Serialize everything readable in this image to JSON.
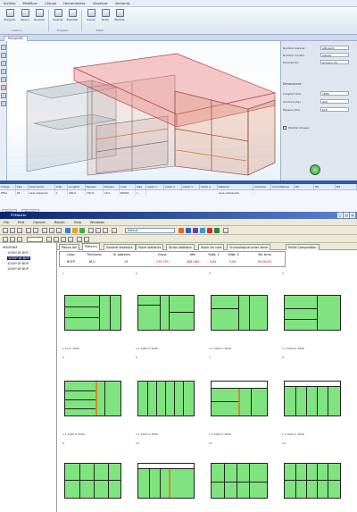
{
  "app": {
    "menu": [
      "Archivo",
      "Modificar",
      "Cálculo",
      "Herramientas",
      "Visualizar",
      "Ventanas"
    ],
    "ribbon": [
      {
        "label": "Proyecto",
        "icon": "folder-icon"
      },
      {
        "label": "Nuevo",
        "icon": "new-file-icon"
      },
      {
        "label": "Guardar",
        "icon": "save-icon"
      },
      {
        "label": "Insertar",
        "icon": "insert-icon"
      },
      {
        "label": "Exportar",
        "icon": "export-icon"
      },
      {
        "label": "Copiar",
        "icon": "copy-icon"
      },
      {
        "label": "Rotar",
        "icon": "rotate-icon"
      },
      {
        "label": "Medida",
        "icon": "measure-icon"
      }
    ],
    "ribbon_groups": [
      "Archivo",
      "Proyecto",
      "Editar"
    ],
    "doc_tab": "MiCapCAD",
    "props": {
      "fields": [
        {
          "label": "Nombre Cabinet",
          "value": "AltCab23"
        },
        {
          "label": "Nombre modelo",
          "value": "AltCab"
        },
        {
          "label": "Descripción",
          "value": "Armario 23"
        }
      ],
      "dimensions_header": "Dimensiones",
      "dims": [
        {
          "label": "Longitud (Dx)",
          "value": "1800"
        },
        {
          "label": "Anchura (Dy)",
          "value": "900"
        },
        {
          "label": "Espesor (Dz)",
          "value": "600"
        }
      ],
      "checkbox": "Mostrar imagen"
    },
    "table": {
      "headers": [
        "Código",
        "Tipo",
        "Descripción",
        "Z-Pic",
        "Longitud",
        "Espesor",
        "Espesor",
        "Color",
        "Veta",
        "Canto 1",
        "Canto 2",
        "Canto 3",
        "Canto 4",
        "Material",
        "Cantidad",
        "Cant.Material",
        "M1",
        "M2",
        "M3"
      ],
      "row": [
        "PTSA",
        "P2",
        "Lado izquierdo",
        "1",
        "900.0",
        "370.0",
        "19.0",
        "BOP16",
        "1",
        "",
        "",
        "",
        "",
        "Laca, blanquedo",
        "",
        "",
        "",
        "",
        ""
      ],
      "bottom_tabs": [
        "Piezas",
        "Herrajes"
      ]
    }
  },
  "optimizer": {
    "title": "PSMaster",
    "window_buttons": [
      "_",
      "□",
      "×"
    ],
    "menu": [
      "File",
      "Edit",
      "Options",
      "Report",
      "Help",
      "Windows"
    ],
    "combo": "Default",
    "tree": {
      "root": "MAGENM",
      "items": [
        "1000*18 BOF",
        "1000*18 BOP",
        "1000*18 BOP",
        "1000*18 BOP"
      ]
    },
    "tabs": [
      "Pieces list",
      "Patterns",
      "General statistics",
      "Panel statistics",
      "Strips statistics",
      "Stock for cuts",
      "Chronological order stock",
      "Pallet Composition"
    ],
    "stats": {
      "headers": [
        "Color",
        "Thickness",
        "N. patterns",
        "Gross",
        "Net",
        "%Wa. 1",
        "%Wa. 2",
        "Tot. time"
      ],
      "values": [
        "BOFP",
        "18,0",
        "13",
        "279,791",
        "264,084",
        "5,62",
        "5,63",
        "00:00:52"
      ]
    },
    "cells": [
      {
        "num": "1",
        "caption": "x 12 0, 1000"
      },
      {
        "num": "2",
        "caption": "x 1 1000 X 3040"
      },
      {
        "num": "3",
        "caption": "x 1 1000 X 3040"
      },
      {
        "num": "4",
        "caption": "x 1 1000 X 3040"
      },
      {
        "num": "5",
        "caption": "x 1 1000 X 3040"
      },
      {
        "num": "6",
        "caption": "x 1 1000 X 3040"
      },
      {
        "num": "7",
        "caption": "x 1 1000 X 3040"
      },
      {
        "num": "8",
        "caption": "x 1 1000 X 3040"
      },
      {
        "num": "9",
        "caption": ""
      },
      {
        "num": "10",
        "caption": ""
      },
      {
        "num": "11",
        "caption": ""
      },
      {
        "num": "12",
        "caption": ""
      }
    ],
    "colors": {
      "panel": "#7fe47f",
      "cut": "#222222",
      "trim": "#d08a2a",
      "title_bar": "#0a246a"
    }
  }
}
